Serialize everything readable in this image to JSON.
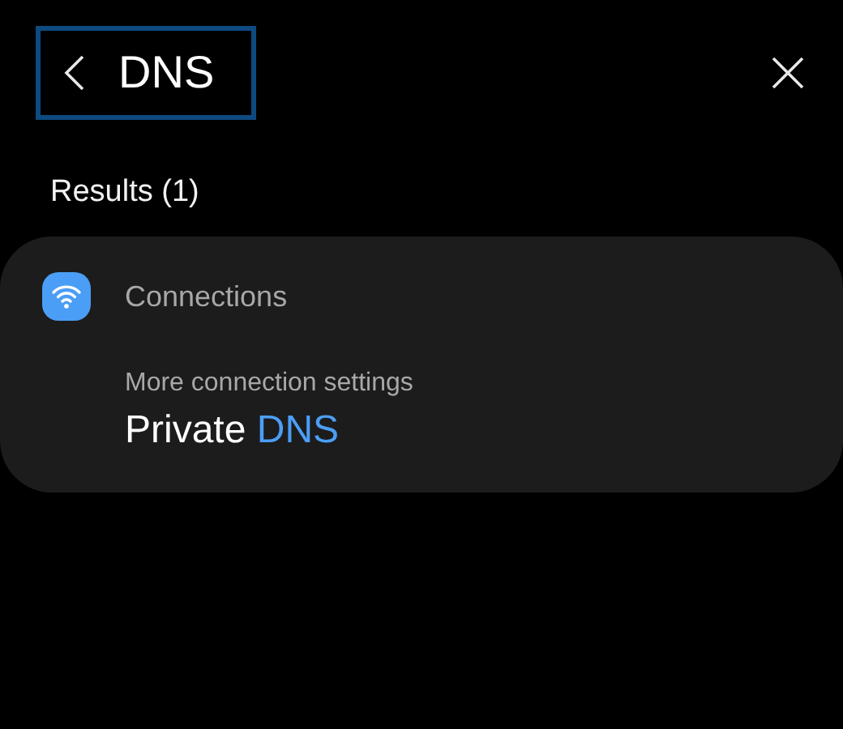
{
  "search": {
    "value": "DNS",
    "focused": true
  },
  "results_header": "Results (1)",
  "results": [
    {
      "category": "Connections",
      "path": "More connection settings",
      "title_parts": [
        {
          "text": "Private ",
          "match": false
        },
        {
          "text": "DNS",
          "match": true
        }
      ]
    }
  ]
}
